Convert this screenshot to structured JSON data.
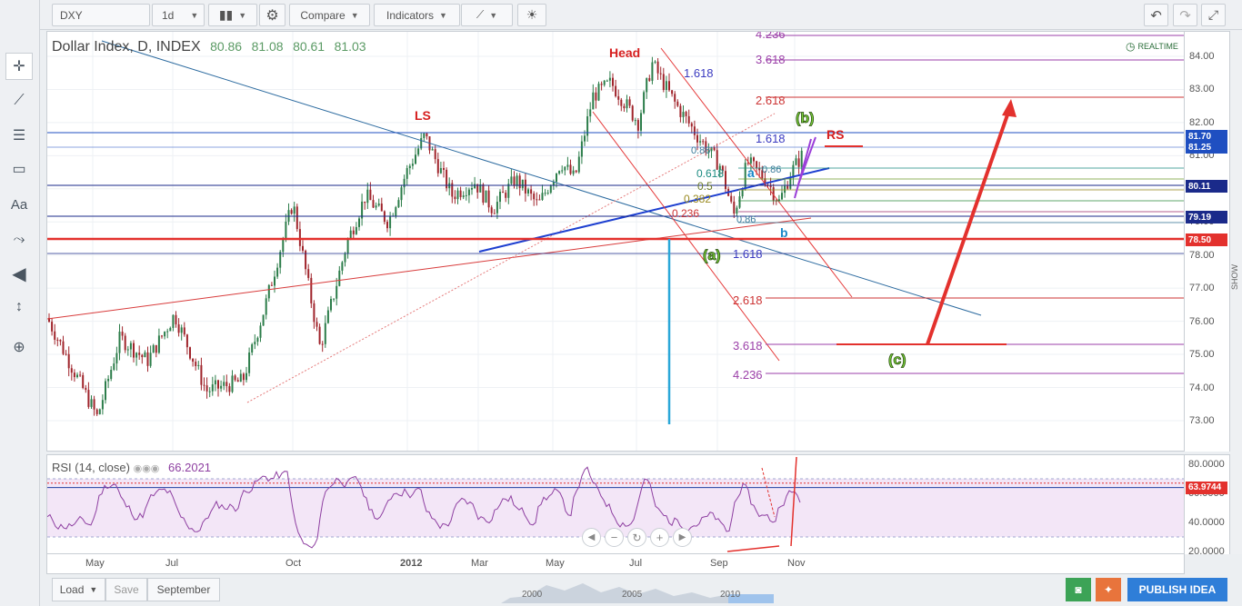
{
  "toolbar": {
    "symbol": "DXY",
    "interval": "1d",
    "compare": "Compare",
    "indicators": "Indicators"
  },
  "legend": {
    "title": "Dollar Index, D, INDEX",
    "open": "80.86",
    "high": "81.08",
    "low": "80.61",
    "close": "81.03"
  },
  "realtime": "REALTIME",
  "price_axis": [
    "84.00",
    "83.00",
    "82.00",
    "81.00",
    "80.00",
    "79.00",
    "78.00",
    "77.00",
    "76.00",
    "75.00",
    "74.00",
    "73.00"
  ],
  "price_tags": [
    {
      "label": "81.70",
      "color": "#1f4fc1"
    },
    {
      "label": "81.25",
      "color": "#1f4fc1"
    },
    {
      "label": "80.11",
      "color": "#1a2a8a"
    },
    {
      "label": "79.19",
      "color": "#1a2a8a"
    },
    {
      "label": "78.50",
      "color": "#e3312d"
    }
  ],
  "rsi": {
    "label": "RSI (14, close)",
    "value": "66.2021",
    "axis": [
      "80.0000",
      "60.0000",
      "40.0000",
      "20.0000"
    ],
    "tag": "63.9744"
  },
  "time_axis": [
    "May",
    "Jul",
    "Oct",
    "2012",
    "Mar",
    "May",
    "Jul",
    "Sep",
    "Nov"
  ],
  "annotations": {
    "head": "Head",
    "ls": "LS",
    "rs": "RS",
    "wave_a_green": "(a)",
    "wave_b_green": "(b)",
    "wave_c_green": "(c)",
    "wave_a_blue": "a",
    "wave_b_blue": "b",
    "fib_top": [
      "4.236",
      "3.618",
      "2.618",
      "1.618",
      "1.618"
    ],
    "fib_bottom": [
      "1.618",
      "2.618",
      "3.618",
      "4.236"
    ],
    "fib_retrace": [
      "0.618",
      "0.5",
      "0.382",
      "0.236",
      "0.86",
      "0.86",
      "0.86"
    ]
  },
  "bottom": {
    "load": "Load",
    "save": "Save",
    "name": "September",
    "navigator_years": [
      "2000",
      "2005",
      "2010"
    ],
    "publish": "PUBLISH IDEA"
  },
  "show_label": "SHOW",
  "colors": {
    "bull": "#2c7d4a",
    "bear": "#a0242b",
    "rsi": "#8e3fa1",
    "accent": "#1f4fc1"
  }
}
